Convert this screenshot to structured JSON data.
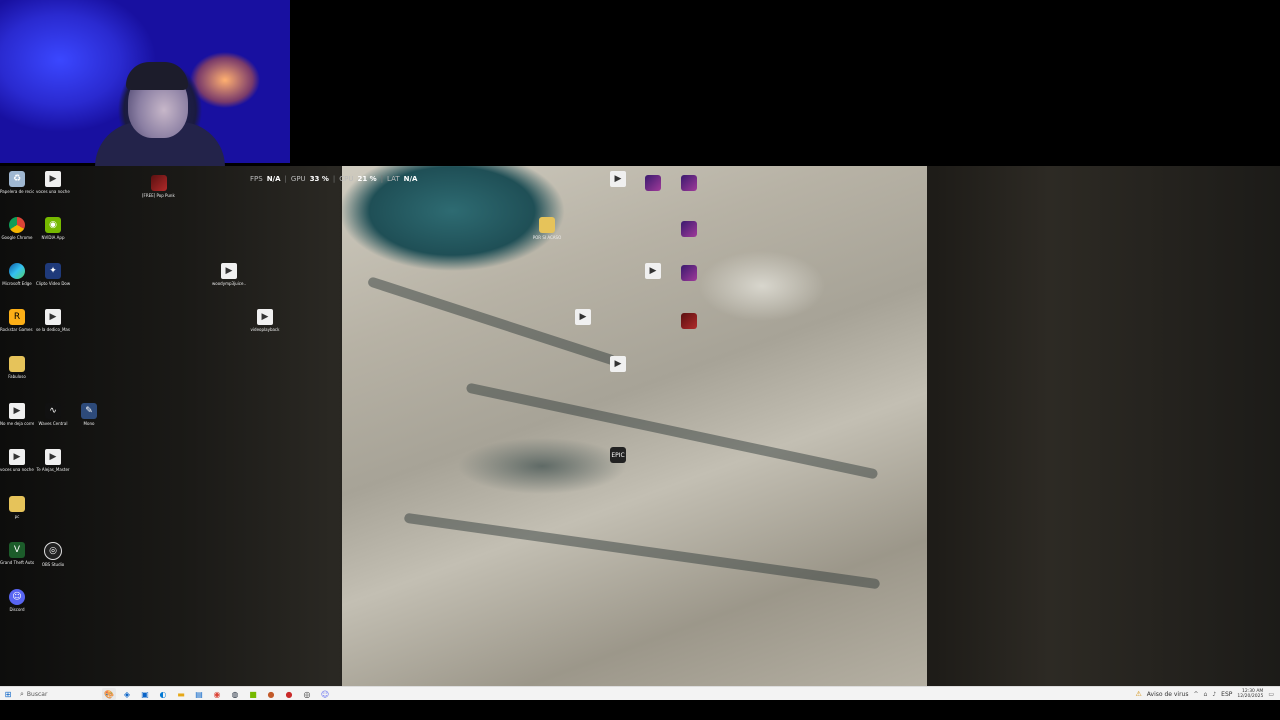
{
  "perf_overlay": {
    "stats": [
      {
        "label": "FPS",
        "value": "N/A"
      },
      {
        "label": "GPU",
        "value": "33 %"
      },
      {
        "label": "CPU",
        "value": "21 %"
      },
      {
        "label": "LAT",
        "value": "N/A"
      }
    ]
  },
  "desktop_icons": {
    "recycle_bin": "Papelera de reciclaje",
    "voces_una_noche_1": "voces una noche mas mas anegl...",
    "pop_punk": "[FREE] Pop Punk x Alternative R...",
    "google_chrome": "Google Chrome",
    "nvidia_app": "NVIDIA App",
    "microsoft_edge": "Microsoft Edge",
    "clipto": "Clipto Video Downloader",
    "wood_file": "woodymp3juice... FREE Kyle Ko...",
    "rockstar": "Rockstar Games Launcher",
    "dedico_master": "se la dedico_Master",
    "videoplayback": "videoplayback",
    "fabuloso": "Fabuloso",
    "no_me_deja": "No me deja correr-2_Master",
    "waves_central": "Waves Central",
    "mono": "Mono",
    "voces_una_noche_2": "voces una noche mas mas_Mas...",
    "te_alejas": "Te Alejas_Master",
    "pc": "pc",
    "gta": "Grand Theft Auto V Enhanced",
    "obs": "OBS Studio",
    "discord": "Discord",
    "por_si_acaso": "POR SI ACASO"
  },
  "icon_names": {
    "file": "file-icon",
    "recycle": "recycle-bin-icon",
    "chrome": "chrome-icon",
    "nvidia": "nvidia-icon",
    "edge": "edge-icon",
    "rockstar": "rockstar-icon",
    "waves": "waves-icon",
    "gta": "gta-icon",
    "obs": "obs-icon",
    "discord": "discord-icon",
    "epic": "epic-games-icon"
  },
  "epic_label": "EPIC",
  "taskbar": {
    "start_glyph": "⊞",
    "search_placeholder": "Buscar",
    "tray_warning": "Aviso de virus",
    "lang": "ESP",
    "time": "12:30 AM",
    "date": "12/20/2025"
  }
}
